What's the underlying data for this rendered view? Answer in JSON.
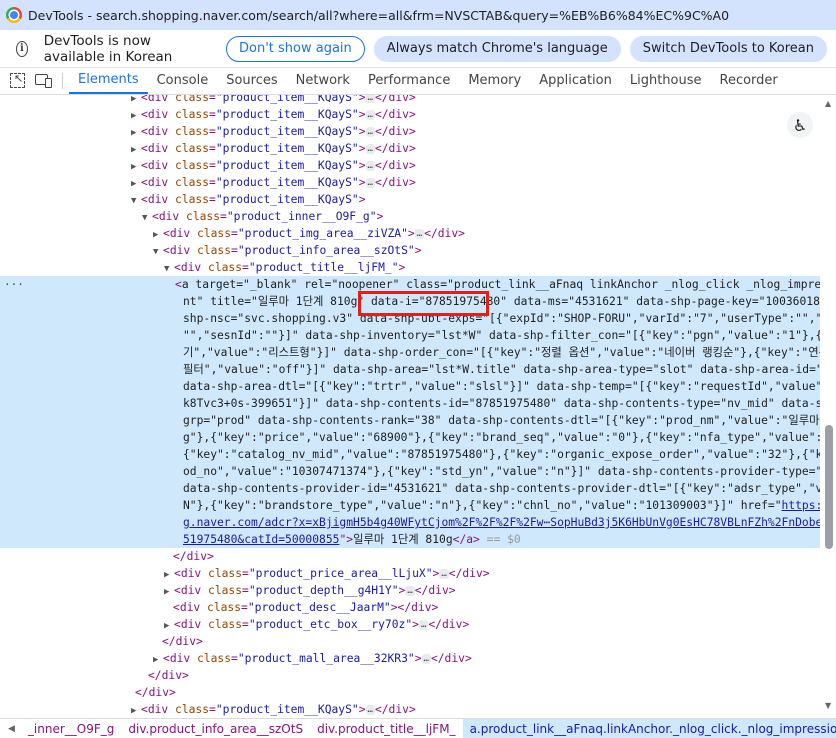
{
  "window": {
    "title": "DevTools - search.shopping.naver.com/search/all?where=all&frm=NVSCTAB&query=%EB%B6%84%EC%9C%A0"
  },
  "infobar": {
    "message": "DevTools is now available in Korean",
    "btn_dont_show": "Don't show again",
    "btn_match_language": "Always match Chrome's language",
    "btn_switch": "Switch DevTools to Korean"
  },
  "tabs": [
    "Elements",
    "Console",
    "Sources",
    "Network",
    "Performance",
    "Memory",
    "Application",
    "Lighthouse",
    "Recorder"
  ],
  "active_tab": "Elements",
  "icons": {
    "inspect": "inspect-element-icon",
    "device": "device-toolbar-icon",
    "accessibility": "accessibility-icon",
    "info": "info-icon"
  },
  "dom": {
    "lt": "<",
    "gt": ">",
    "eq": "=",
    "div": "div",
    "a": "a",
    "div_close": "</div>",
    "a_close": "</a>",
    "class": "class",
    "ellipsis": "…",
    "q": "\"",
    "item_class": "product_item__KQayS",
    "inner_class": "product_inner__O9F_g",
    "img_class": "product_img_area__ziVZA",
    "info_class": "product_info_area__szOtS",
    "title_class": "product_title__ljFM_",
    "price_class": "product_price_area__lLjuX",
    "depth_class": "product_depth__g4H1Y",
    "desc_class": "product_desc__JaarM",
    "etc_class": "product_etc_box__ry70z",
    "mall_class": "product_mall_area__32KR3",
    "eq_dollar": "== $0",
    "gutter": "···",
    "anchor_lines": [
      "a target=\"_blank\" rel=\"noopener\" class=\"product_link__aFnaq linkAnchor _nlog_click _nlog_impression_eleme",
      "nt\" title=\"일루마 1단계 810g\" data-i=\"87851975480\" data-ms=\"4531621\" data-shp-page-key=\"100360185\" data-",
      "shp-nsc=\"svc.shopping.v3\" data-shp-ubt-exps=\"[{\"expId\":\"SHOP-FORU\",\"varId\":\"7\",\"userType\":\"\",\"provId\":",
      "\"\",\"sesnId\":\"\"}]\" data-shp-inventory=\"lst*W\" data-shp-filter_con=\"[{\"key\":\"pgn\",\"value\":\"1\"},{\"key\":\"보",
      "기\",\"value\":\"리스트형\"}]\" data-shp-order_con=\"[{\"key\":\"정렬 옵션\",\"value\":\"네이버 랭킹순\"},{\"key\":\"연관도",
      "필터\",\"value\":\"off\"}]\" data-shp-area=\"lst*W.title\" data-shp-area-type=\"slot\" data-shp-area-id=\"title\"",
      "data-shp-area-dtl=\"[{\"key\":\"trtr\",\"value\":\"slsl\"}]\" data-shp-temp=\"[{\"key\":\"requestId\",\"value\":\"jZBxZwqWng",
      "k8Tvc3+0s-399651\"}]\" data-shp-contents-id=\"87851975480\" data-shp-contents-type=\"nv_mid\" data-shp-contents-",
      "grp=\"prod\" data-shp-contents-rank=\"38\" data-shp-contents-dtl=\"[{\"key\":\"prod_nm\",\"value\":\"일루마 1단계 810",
      "g\"},{\"key\":\"price\",\"value\":\"68900\"},{\"key\":\"brand_seq\",\"value\":\"0\"},{\"key\":\"nfa_type\",\"value\":\"NORMAL\"},",
      "{\"key\":\"catalog_nv_mid\",\"value\":\"87851975480\"},{\"key\":\"organic_expose_order\",\"value\":\"32\"},{\"key\":\"chnl_pr",
      "od_no\",\"value\":\"10307471374\"},{\"key\":\"std_yn\",\"value\":\"n\"}]\" data-shp-contents-provider-type=\"mall_seq\"",
      "data-shp-contents-provider-id=\"4531621\" data-shp-contents-provider-dtl=\"[{\"key\":\"adsr_type\",\"value\":\"SHOP",
      "N\"},{\"key\":\"brandstore_type\",\"value\":\"n\"},{\"key\":\"chnl_no\",\"value\":\"101309003\"}]\" href=\"",
      "https://cr.shoppin",
      "g.naver.com/adcr?x=xBjigmH5b4g40WFytCjom%2F%2F%2F%2Fw⋯SopHuBd3j5K6HbUnVg0EsHC78VBLnFZh%2FnDobeN%nvMid=878",
      "51975480&catId=50000855",
      "일루마 1단계 810g"
    ]
  },
  "breadcrumbs": [
    "_inner__O9F_g",
    "div.product_info_area__szOtS",
    "div.product_title__ljFM_",
    "a.product_link__aFnaq.linkAnchor._nlog_click._nlog_impression_element"
  ]
}
